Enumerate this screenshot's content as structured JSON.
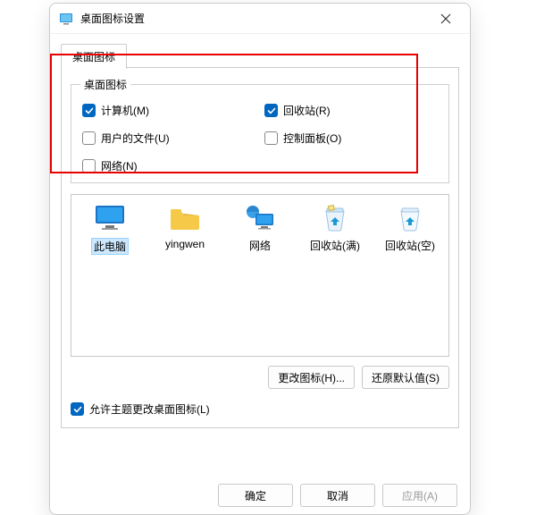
{
  "title": "桌面图标设置",
  "tab": "桌面图标",
  "group_title": "桌面图标",
  "checks": {
    "computer": {
      "label": "计算机(M)",
      "checked": true
    },
    "recycle": {
      "label": "回收站(R)",
      "checked": true
    },
    "userfiles": {
      "label": "用户的文件(U)",
      "checked": false
    },
    "ctrlpanel": {
      "label": "控制面板(O)",
      "checked": false
    },
    "network": {
      "label": "网络(N)",
      "checked": false
    }
  },
  "icons": {
    "thispc": "此电脑",
    "yingwen": "yingwen",
    "network": "网络",
    "bin_full": "回收站(满)",
    "bin_empty": "回收站(空)"
  },
  "buttons": {
    "change_icon": "更改图标(H)...",
    "restore": "还原默认值(S)",
    "ok": "确定",
    "cancel": "取消",
    "apply": "应用(A)"
  },
  "perm_label": "允许主题更改桌面图标(L)",
  "perm_checked": true
}
